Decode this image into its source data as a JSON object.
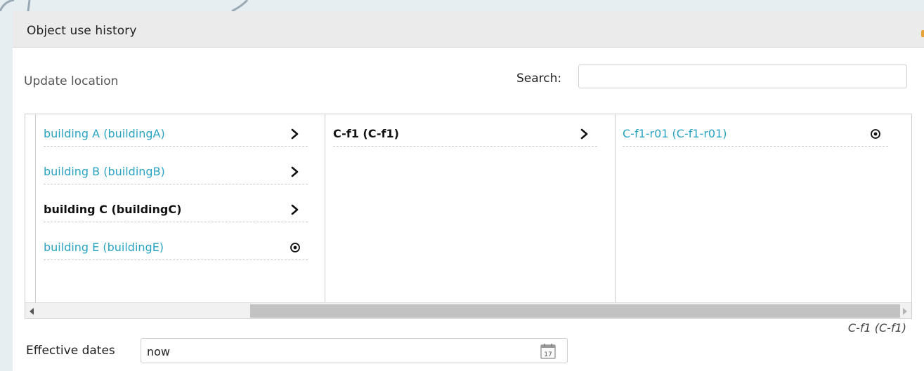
{
  "panel": {
    "title": "Object use history"
  },
  "location": {
    "section_label": "Update location",
    "search_label": "Search:",
    "search_value": "",
    "columns": [
      {
        "items": [
          {
            "label": "building A (buildingA)",
            "icon": "chevron-right-icon",
            "active": false
          },
          {
            "label": "building B (buildingB)",
            "icon": "chevron-right-icon",
            "active": false
          },
          {
            "label": "building C (buildingC)",
            "icon": "chevron-right-icon",
            "active": true
          },
          {
            "label": "building E (buildingE)",
            "icon": "radio-target-icon",
            "active": false
          }
        ]
      },
      {
        "items": [
          {
            "label": "C-f1 (C-f1)",
            "icon": "chevron-right-icon",
            "active": true
          }
        ]
      },
      {
        "items": [
          {
            "label": "C-f1-r01 (C-f1-r01)",
            "icon": "radio-target-icon",
            "active": false
          }
        ]
      }
    ],
    "current_path": "C-f1 (C-f1)"
  },
  "effective_dates": {
    "label": "Effective dates",
    "value": "now",
    "calendar_day": "17"
  },
  "colors": {
    "link": "#2aa3c3",
    "active": "#111111",
    "header_bg": "#ebebeb",
    "accent": "#e8a23a"
  }
}
